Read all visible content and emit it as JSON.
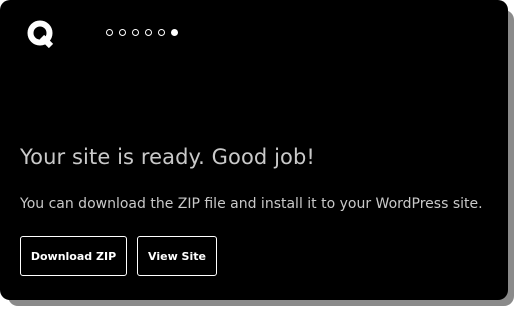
{
  "pager": {
    "steps": 6,
    "current_step": 6
  },
  "main": {
    "headline": "Your site is ready. Good job!",
    "subtext": "You can download the ZIP file and install it to your WordPress site."
  },
  "actions": {
    "download_label": "Download ZIP",
    "view_label": "View Site"
  },
  "icons": {
    "logo": "q-logo-icon"
  },
  "colors": {
    "background": "#000000",
    "text": "#c9c9c9",
    "button_border": "#ffffff"
  }
}
